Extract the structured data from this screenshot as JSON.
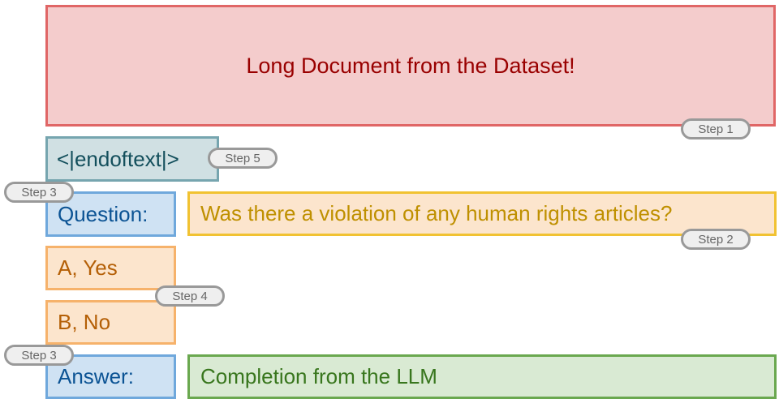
{
  "document": {
    "text": "Long Document from the Dataset!"
  },
  "end_of_text": {
    "text": "<|endoftext|>"
  },
  "question": {
    "label": "Question:",
    "text": "Was there a violation of any human rights articles?"
  },
  "options": [
    {
      "text": "A, Yes"
    },
    {
      "text": "B, No"
    }
  ],
  "answer": {
    "label": "Answer:",
    "completion": "Completion from the LLM"
  },
  "steps": {
    "document": "Step 1",
    "question_text": "Step 2",
    "question_label": "Step 3",
    "options": "Step 4",
    "end_of_text": "Step 5",
    "answer_label": "Step 3"
  },
  "colors": {
    "document_fill": "#f4cccc",
    "document_border": "#e06666",
    "eot_fill": "#d0e0e3",
    "label_fill": "#cfe2f3",
    "question_fill": "#fce5cd",
    "question_border": "#f1c232",
    "option_border": "#f6b26b",
    "completion_fill": "#d9ead3",
    "completion_border": "#6aa84f",
    "step_border": "#999999"
  }
}
